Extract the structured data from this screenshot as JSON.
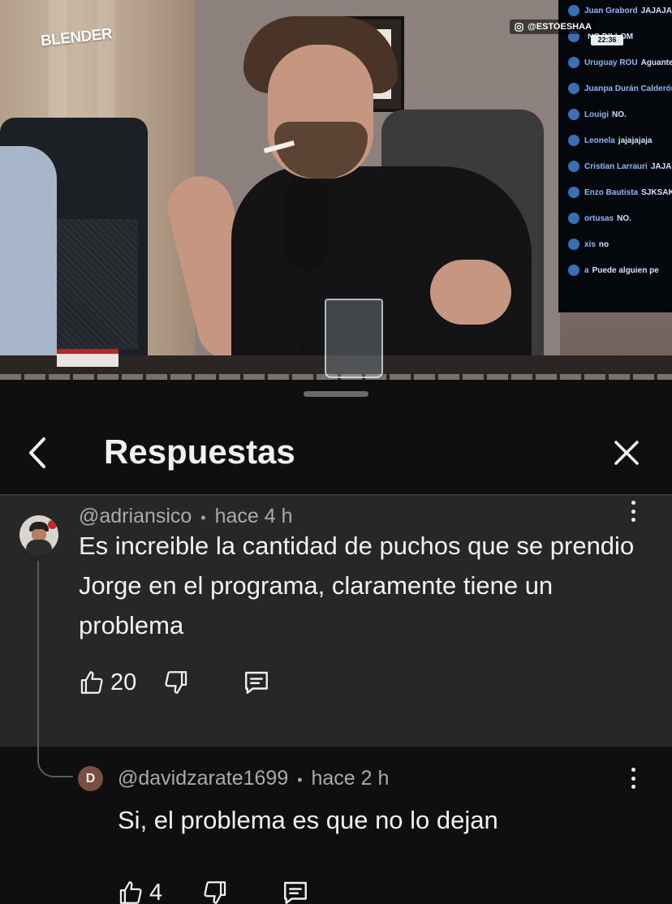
{
  "video": {
    "logo": "BLENDER",
    "ig_handle": "@ESTOESHAA",
    "stream_time": "22:36",
    "chat": [
      {
        "name": "Juan Grabord",
        "msg": "JAJAJA"
      },
      {
        "name": "",
        "msg": "NO DILLOM"
      },
      {
        "name": "Uruguay ROU",
        "msg": "Aguante"
      },
      {
        "name": "Juanpa Durán Calderón",
        "msg": ""
      },
      {
        "name": "Louigi",
        "msg": "NO."
      },
      {
        "name": "Leonela",
        "msg": "jajajajaja"
      },
      {
        "name": "Cristian Larrauri",
        "msg": "JAJA"
      },
      {
        "name": "Enzo Bautista",
        "msg": "SJKSAK"
      },
      {
        "name": "ortusas",
        "msg": "NO."
      },
      {
        "name": "xis",
        "msg": "no"
      },
      {
        "name": "a",
        "msg": "Puede alguien pe"
      }
    ]
  },
  "header": {
    "title": "Respuestas",
    "back_icon": "chevron-left-icon",
    "close_icon": "close-icon"
  },
  "parent_comment": {
    "author": "@adriansico",
    "separator": "•",
    "time": "hace 4 h",
    "text": "Es increible la cantidad de puchos que se prendio Jorge en el programa, claramente tiene un problema",
    "likes": "20"
  },
  "reply": {
    "avatar_letter": "D",
    "author": "@davidzarate1699",
    "separator": "•",
    "time": "hace 2 h",
    "text": "Si, el problema es que no lo dejan",
    "likes": "4"
  },
  "colors": {
    "background": "#0f0f0f",
    "highlighted_comment": "#272727",
    "text_primary": "#f1f1f1",
    "text_secondary": "#aaaaaa",
    "reply_avatar": "#7a4d45"
  }
}
